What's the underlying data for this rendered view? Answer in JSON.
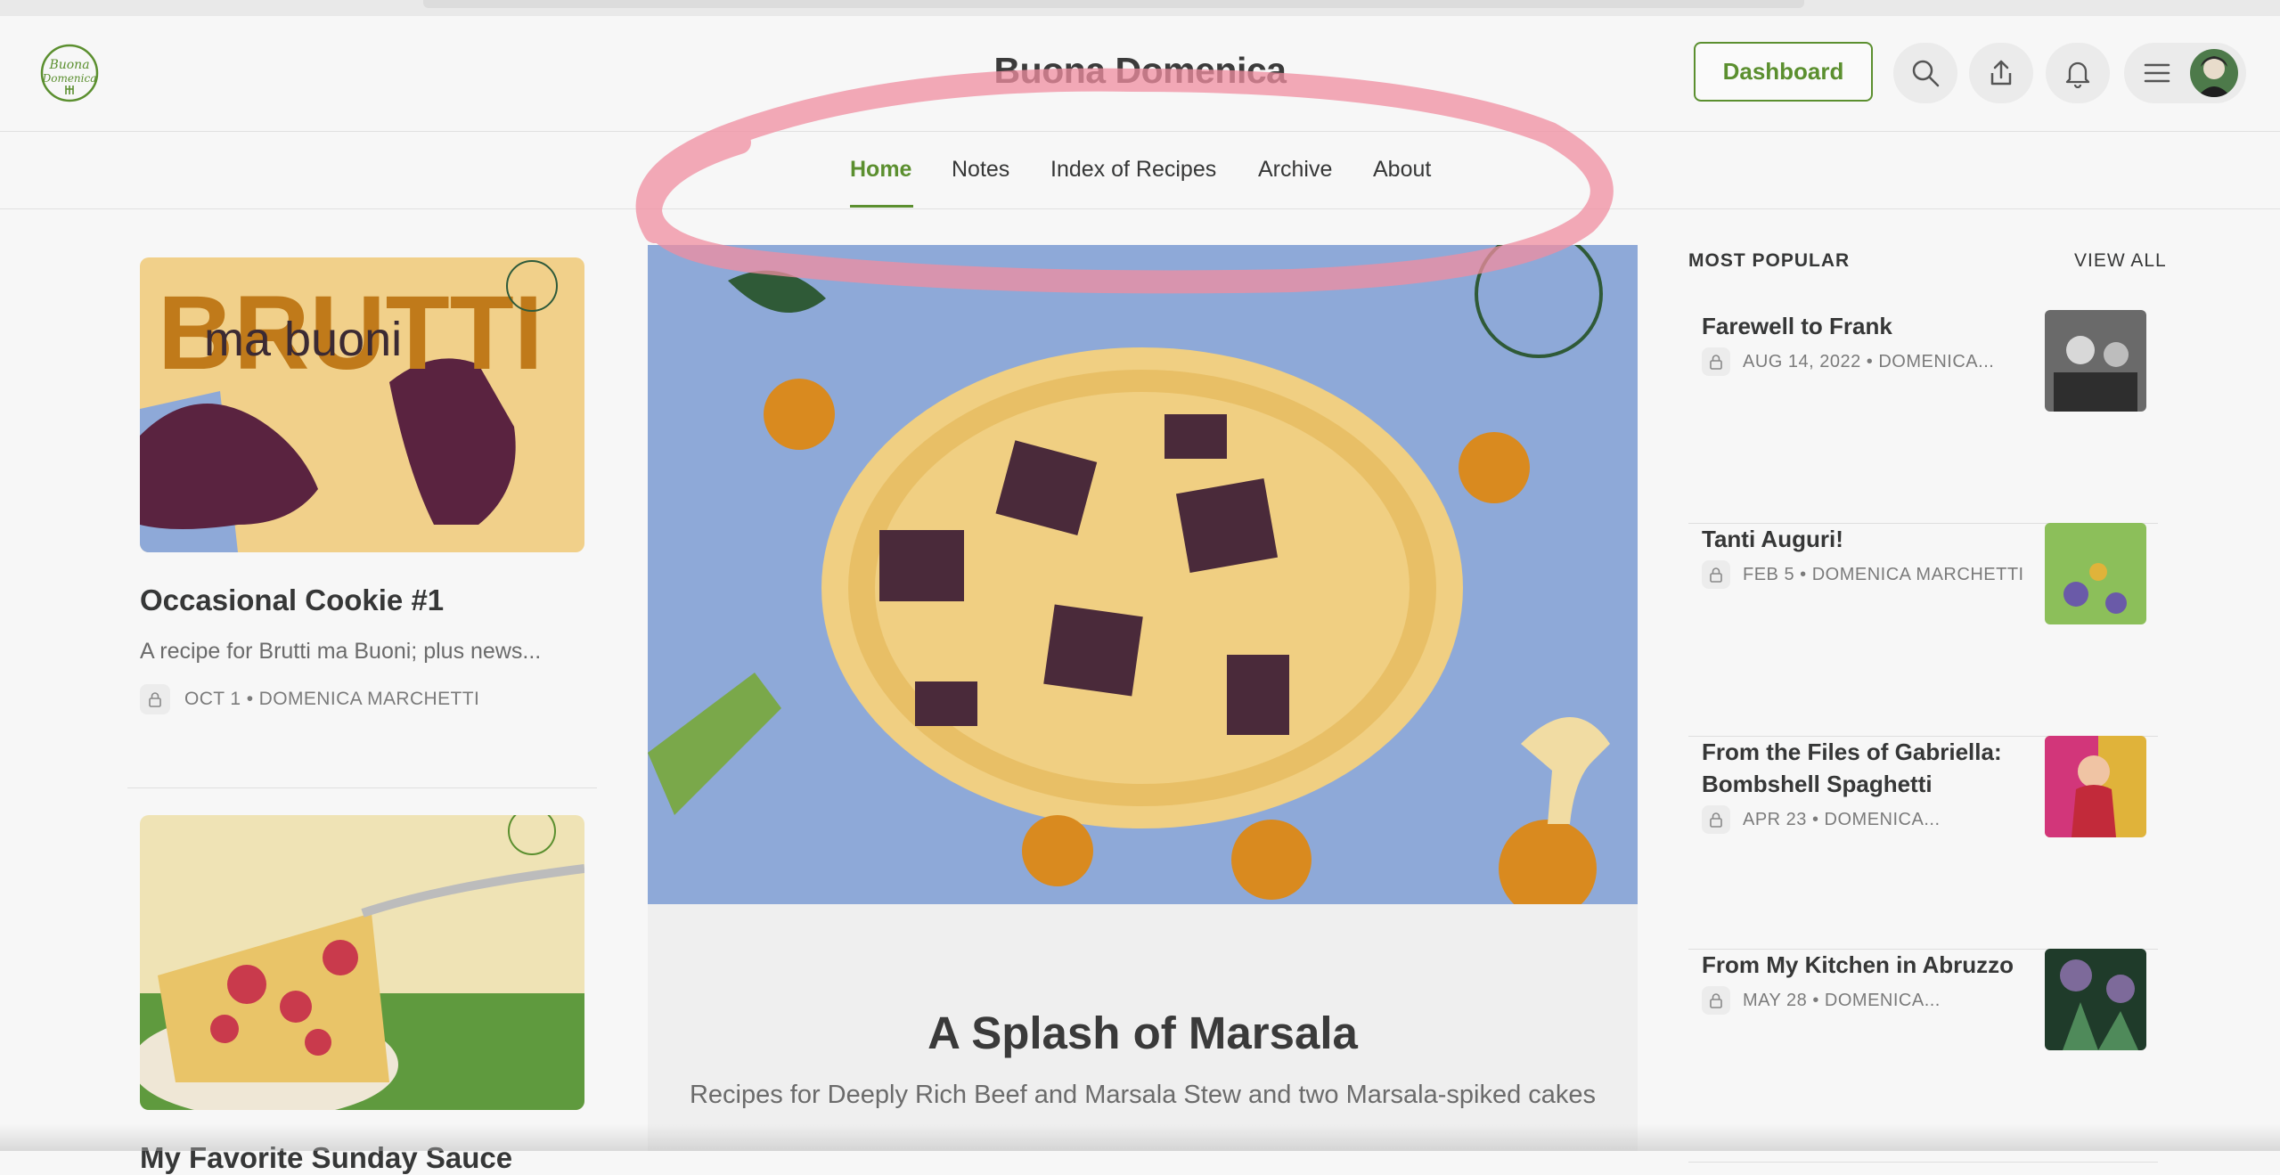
{
  "site": {
    "title": "Buona Domenica",
    "logo_text": "Buona Domenica"
  },
  "header": {
    "dashboard_label": "Dashboard"
  },
  "nav": {
    "items": [
      "Home",
      "Notes",
      "Index of Recipes",
      "Archive",
      "About"
    ],
    "active": "Home"
  },
  "left_posts": [
    {
      "title": "Occasional Cookie #1",
      "subtitle": "A recipe for Brutti ma Buoni; plus news...",
      "meta": "OCT 1 • DOMENICA MARCHETTI",
      "image_text_1": "BRUTTI",
      "image_text_2": "ma buoni"
    },
    {
      "title": "My Favorite Sunday Sauce"
    }
  ],
  "featured": {
    "title": "A Splash of Marsala",
    "subtitle": "Recipes for Deeply Rich Beef and Marsala Stew and two Marsala-spiked cakes"
  },
  "popular": {
    "heading": "MOST POPULAR",
    "view_all": "VIEW ALL",
    "items": [
      {
        "title": "Farewell to Frank",
        "meta": "AUG 14, 2022 • DOMENICA..."
      },
      {
        "title": "Tanti Auguri!",
        "meta": "FEB 5 • DOMENICA MARCHETTI"
      },
      {
        "title": "From the Files of Gabriella: Bombshell Spaghetti",
        "meta": "APR 23 • DOMENICA..."
      },
      {
        "title": "From My Kitchen in Abruzzo",
        "meta": "MAY 28 • DOMENICA..."
      }
    ]
  },
  "colors": {
    "accent": "#5b8f2f",
    "annotation": "#f08ea0",
    "hero_bg": "#8ea9d8"
  },
  "icons": [
    "search-icon",
    "share-icon",
    "bell-icon",
    "hamburger-icon",
    "lock-icon"
  ]
}
